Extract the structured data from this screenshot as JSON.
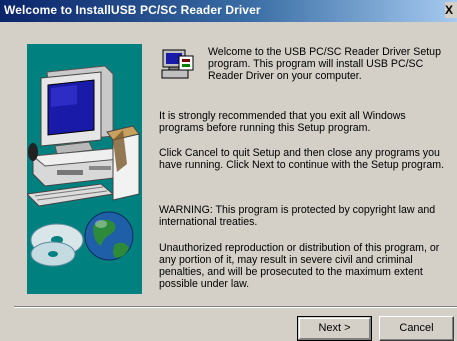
{
  "window": {
    "title": "Welcome to InstallUSB PC/SC Reader Driver",
    "close_glyph": "X"
  },
  "icons": {
    "setup": "setup-computer-icon",
    "illustration": "computer-with-cd-and-globe"
  },
  "content": {
    "welcome": "Welcome to the USB PC/SC Reader Driver Setup program.  This program will install USB PC/SC Reader Driver on your computer.",
    "recommend": "It is strongly recommended that you exit all Windows programs before running this Setup program.",
    "cancel_info": "Click Cancel to quit Setup and then close any programs you have running.  Click Next to continue with the Setup program.",
    "warning": "WARNING: This program is protected by copyright law and international treaties.",
    "unauthorized": "Unauthorized reproduction or distribution of this program, or any portion of it, may result in severe civil and criminal penalties, and will be prosecuted to the maximum extent possible under law."
  },
  "buttons": {
    "next": "Next >",
    "cancel": "Cancel"
  },
  "colors": {
    "title_bar_start": "#0a246a",
    "title_bar_end": "#a6caf0",
    "dialog_background": "#d4d0c8",
    "illustration_background": "#00807f"
  }
}
